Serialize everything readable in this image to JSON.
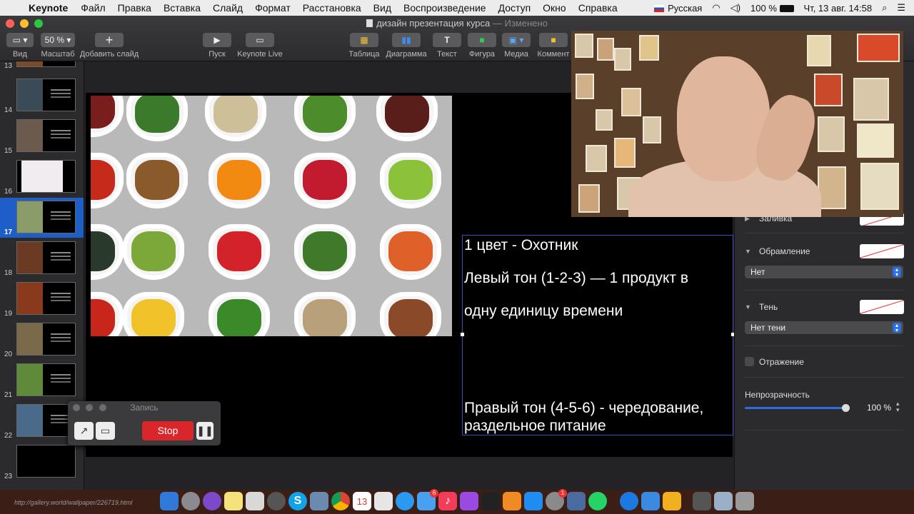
{
  "menubar": {
    "app_name": "Keynote",
    "items": [
      "Файл",
      "Правка",
      "Вставка",
      "Слайд",
      "Формат",
      "Расстановка",
      "Вид",
      "Воспроизведение",
      "Доступ",
      "Окно",
      "Справка"
    ],
    "input_source": "Русская",
    "battery": "100 %",
    "clock": "Чт, 13 авг.  14:58"
  },
  "window": {
    "title": "дизайн презентация курса",
    "status": "— Изменено"
  },
  "toolbar": {
    "view_label": "Вид",
    "zoom_value": "50 %",
    "zoom_label": "Масштаб",
    "add_slide_label": "Добавить слайд",
    "play_label": "Пуск",
    "live_label": "Keynote Live",
    "table_label": "Таблица",
    "chart_label": "Диаграмма",
    "text_label": "Текст",
    "shape_label": "Фигура",
    "media_label": "Медиа",
    "comment_label": "Коммент"
  },
  "navigator": {
    "slides": [
      {
        "num": "13"
      },
      {
        "num": "14"
      },
      {
        "num": "15"
      },
      {
        "num": "16"
      },
      {
        "num": "17"
      },
      {
        "num": "18"
      },
      {
        "num": "19"
      },
      {
        "num": "20"
      },
      {
        "num": "21"
      },
      {
        "num": "22"
      },
      {
        "num": "23"
      }
    ],
    "selected": "17"
  },
  "slide": {
    "line1": "1 цвет - Охотник",
    "line2": "Левый тон (1-2-3) — 1 продукт в",
    "line3": "одну единицу времени",
    "line4": "Правый тон (4-5-6) - чередование,",
    "line5": "раздельное питание"
  },
  "inspector": {
    "fill_label": "Заливка",
    "border_label": "Обрамление",
    "border_value": "Нет",
    "shadow_label": "Тень",
    "shadow_value": "Нет тени",
    "reflection_label": "Отражение",
    "opacity_label": "Непрозрачность",
    "opacity_value": "100 %"
  },
  "recorder": {
    "title": "Запись",
    "stop_label": "Stop"
  },
  "dock": {
    "url": "http://gallery.world/wallpaper/226719.html",
    "calendar_day": "13",
    "mail_badge": "6",
    "prefs_badge": "1"
  }
}
